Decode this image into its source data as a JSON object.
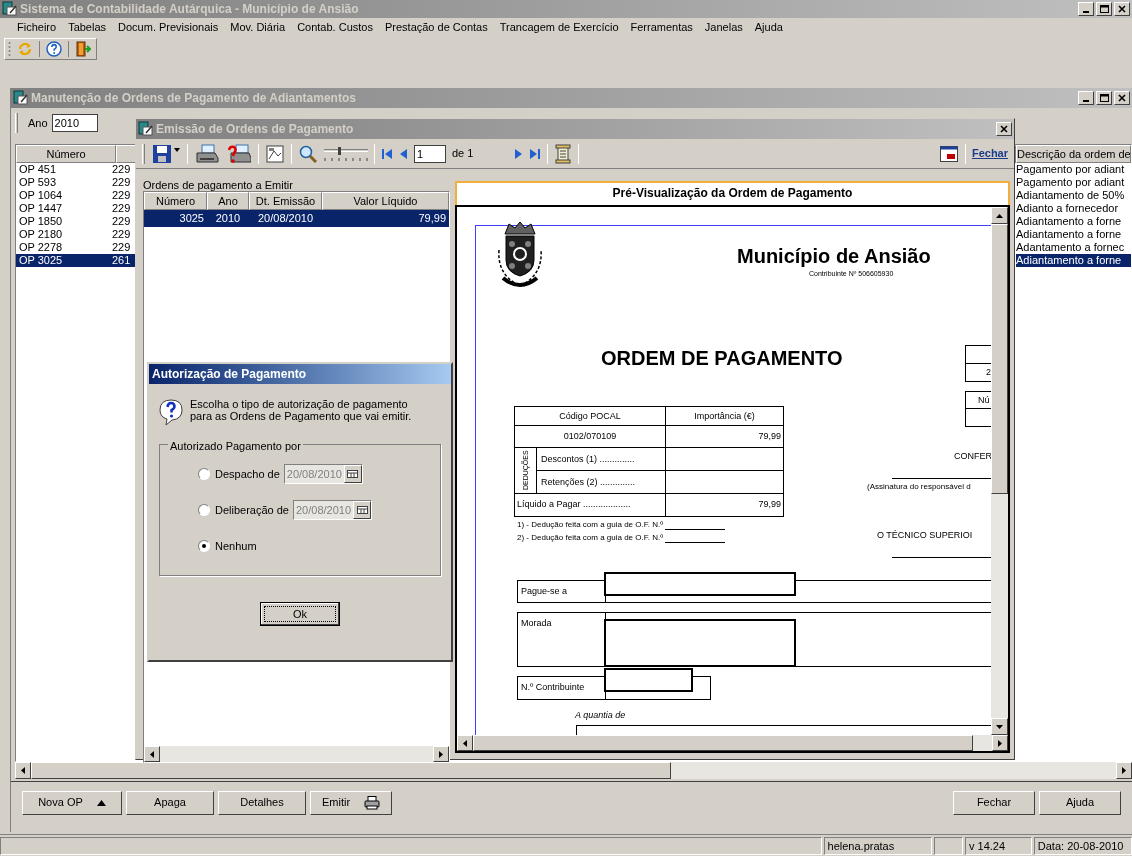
{
  "window": {
    "title": "Sistema de Contabilidade Autárquica - Município de Ansião"
  },
  "menu": [
    "Ficheiro",
    "Tabelas",
    "Docum. Previsionais",
    "Mov. Diária",
    "Contab. Custos",
    "Prestação de Contas",
    "Trancagem de Exercício",
    "Ferramentas",
    "Janelas",
    "Ajuda"
  ],
  "child_window": {
    "title": "Manutenção de Ordens de Pagamento de Adiantamentos",
    "year_label": "Ano",
    "year": "2010",
    "list": {
      "columns": [
        "Número",
        "Descrição da ordem de"
      ],
      "rows": [
        {
          "number": "OP 451",
          "column_2": "229",
          "description": "Pagamento por adiant",
          "selected": false
        },
        {
          "number": "OP 593",
          "column_2": "229",
          "description": "Pagamento por adiant",
          "selected": false
        },
        {
          "number": "OP 1064",
          "column_2": "229",
          "description": "Adiantamento de 50%",
          "selected": false
        },
        {
          "number": "OP 1447",
          "column_2": "229",
          "description": "Adianto a fornecedor",
          "selected": false
        },
        {
          "number": "OP 1850",
          "column_2": "229",
          "description": "Adiantamento a forne",
          "selected": false
        },
        {
          "number": "OP 2180",
          "column_2": "229",
          "description": "Adiantamento a forne",
          "selected": false
        },
        {
          "number": "OP 2278",
          "column_2": "229",
          "description": "Adantamento a fornec",
          "selected": false
        },
        {
          "number": "OP 3025",
          "column_2": "261",
          "description": "Adiantamento a forne",
          "selected": true
        }
      ]
    },
    "buttons_left": [
      {
        "label": "Nova OP",
        "kind": "menu"
      },
      {
        "label": "Apaga"
      },
      {
        "label": "Detalhes"
      },
      {
        "label": "Emitir",
        "kind": "print"
      }
    ],
    "buttons_right": [
      {
        "label": "Fechar"
      },
      {
        "label": "Ajuda"
      }
    ]
  },
  "emission_window": {
    "title": "Emissão de Ordens de Pagamento",
    "zoom": {
      "level": 0.35
    },
    "page": "1",
    "page_count": "de 1",
    "close_link": "Fechar",
    "list_label": "Ordens de pagamento a Emitir",
    "table": {
      "columns": [
        "Número",
        "Ano",
        "Dt. Emissão",
        "Valor Líquido"
      ],
      "rows": [
        {
          "number": "3025",
          "year": "2010",
          "date": "20/08/2010",
          "value": "79,99",
          "selected": true
        }
      ]
    },
    "preview": {
      "header": "Pré-Visualização da Ordem de Pagamento",
      "document": {
        "entity": "Município de Ansião",
        "tax_id": "Contribuinte Nº 506605930",
        "heading": "ORDEM DE PAGAMENTO",
        "table": {
          "header": [
            "Código POCAL",
            "Importância (€)"
          ],
          "code": "0102/070109",
          "amount": "79,99",
          "deductions_label": "DEDUÇÕES",
          "deductions": [
            "Descontos (1) ..............",
            "Retenções (2) .............."
          ],
          "net_label": "Líquido a Pagar ...................",
          "net": "79,99"
        },
        "footnotes": [
          "1) - Dedução feita com a guia de O.F. N.º",
          "2) - Dedução feita com a guia de O.F. N.º"
        ],
        "side": {
          "box_1": "2",
          "box_2": "Nú",
          "conference": "CONFER",
          "signature_note": "(Assinatura do responsável d",
          "technician": "O TÉCNICO SUPERIOI"
        },
        "fields": [
          "Pague-se a",
          "Morada",
          "N.º Contribuinte"
        ],
        "amount_label": "A quantia de"
      }
    }
  },
  "dialog": {
    "title": "Autorização de Pagamento",
    "message": "Escolha o tipo de autorização de pagamento para as Ordens de Pagamento que vai emitir.",
    "group_label": "Autorizado Pagamento por",
    "options": [
      {
        "label": "Despacho de",
        "date": "20/08/2010",
        "selected": false
      },
      {
        "label": "Deliberação de",
        "date": "20/08/2010",
        "selected": false
      },
      {
        "label": "Nenhum",
        "selected": true
      }
    ],
    "ok": "Ok"
  },
  "status_bar": [
    "helena.pratas",
    "v 14.24",
    "Data: 20-08-2010"
  ]
}
